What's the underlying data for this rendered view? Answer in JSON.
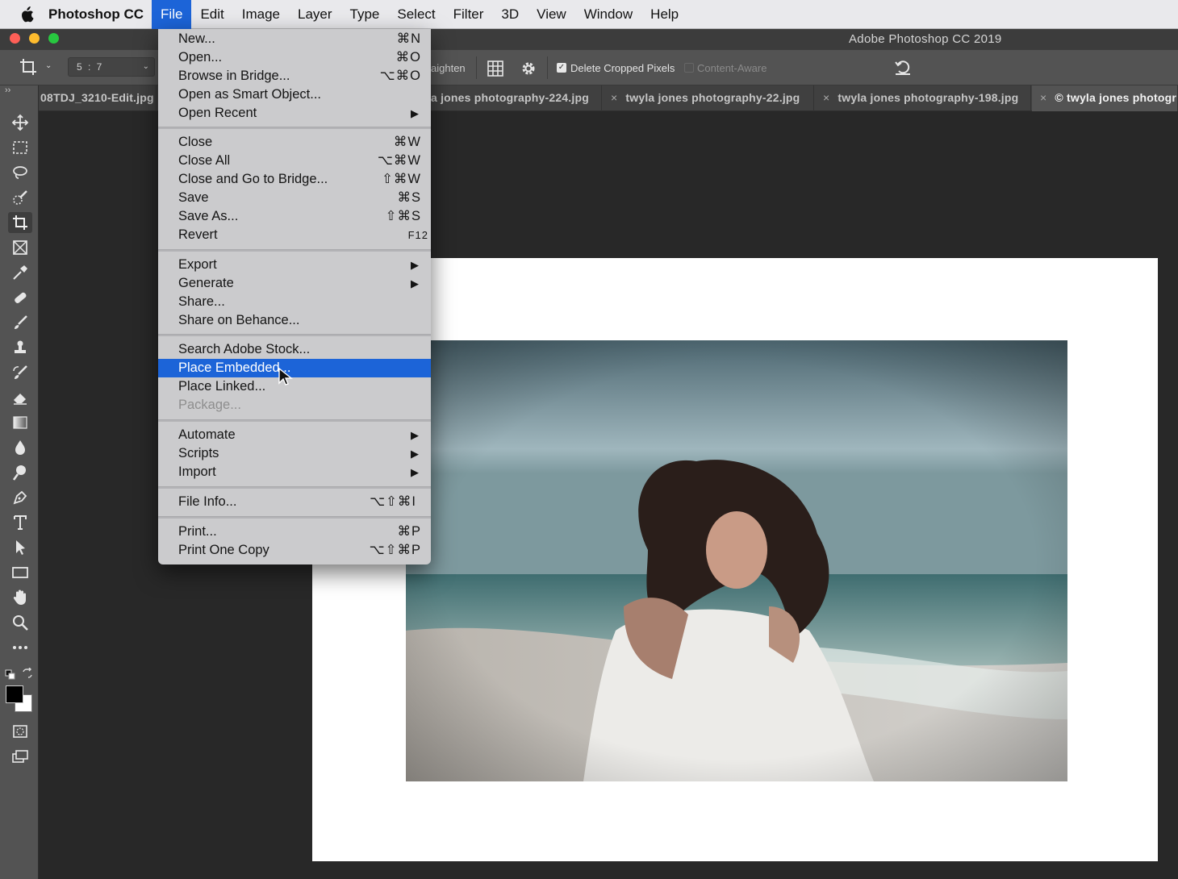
{
  "menubar": {
    "app_name": "Photoshop CC",
    "items": [
      "File",
      "Edit",
      "Image",
      "Layer",
      "Type",
      "Select",
      "Filter",
      "3D",
      "View",
      "Window",
      "Help"
    ],
    "active": "File"
  },
  "window": {
    "title": "Adobe Photoshop CC 2019"
  },
  "options_bar": {
    "ratio": "5 : 7",
    "straighten_label": "aighten",
    "delete_cropped_label": "Delete Cropped Pixels",
    "delete_cropped_checked": true,
    "content_aware_label": "Content-Aware",
    "content_aware_checked": false
  },
  "tabs": [
    {
      "label": "08TDJ_3210-Edit.jpg",
      "closable": false
    },
    {
      "label": "a jones photography-224.jpg",
      "closable": false
    },
    {
      "label": "twyla jones photography-22.jpg",
      "closable": true
    },
    {
      "label": "twyla jones photography-198.jpg",
      "closable": true
    },
    {
      "label": "© twyla jones photogr",
      "closable": true,
      "active": true
    }
  ],
  "close_glyph": "×",
  "tools": [
    "move-tool",
    "marquee-tool",
    "lasso-tool",
    "quick-selection-tool",
    "crop-tool",
    "frame-tool",
    "eyedropper-tool",
    "healing-brush-tool",
    "brush-tool",
    "clone-stamp-tool",
    "history-brush-tool",
    "eraser-tool",
    "gradient-tool",
    "blur-tool",
    "dodge-tool",
    "pen-tool",
    "type-tool",
    "path-selection-tool",
    "rectangle-tool",
    "hand-tool",
    "zoom-tool",
    "edit-toolbar",
    "quick-mask-mode",
    "screen-mode"
  ],
  "active_tool": "crop-tool",
  "colors": {
    "foreground": "#000000",
    "background": "#ffffff",
    "highlight": "#1c64d8"
  },
  "file_menu": {
    "groups": [
      [
        {
          "label": "New...",
          "shortcut": "⌘N"
        },
        {
          "label": "Open...",
          "shortcut": "⌘O"
        },
        {
          "label": "Browse in Bridge...",
          "shortcut": "⌥⌘O"
        },
        {
          "label": "Open as Smart Object...",
          "shortcut": ""
        },
        {
          "label": "Open Recent",
          "shortcut": "",
          "submenu": true
        }
      ],
      [
        {
          "label": "Close",
          "shortcut": "⌘W"
        },
        {
          "label": "Close All",
          "shortcut": "⌥⌘W"
        },
        {
          "label": "Close and Go to Bridge...",
          "shortcut": "⇧⌘W"
        },
        {
          "label": "Save",
          "shortcut": "⌘S"
        },
        {
          "label": "Save As...",
          "shortcut": "⇧⌘S"
        },
        {
          "label": "Revert",
          "shortcut": "F12"
        }
      ],
      [
        {
          "label": "Export",
          "shortcut": "",
          "submenu": true
        },
        {
          "label": "Generate",
          "shortcut": "",
          "submenu": true
        },
        {
          "label": "Share...",
          "shortcut": ""
        },
        {
          "label": "Share on Behance...",
          "shortcut": ""
        }
      ],
      [
        {
          "label": "Search Adobe Stock...",
          "shortcut": ""
        },
        {
          "label": "Place Embedded...",
          "shortcut": "",
          "highlighted": true
        },
        {
          "label": "Place Linked...",
          "shortcut": ""
        },
        {
          "label": "Package...",
          "shortcut": "",
          "disabled": true
        }
      ],
      [
        {
          "label": "Automate",
          "shortcut": "",
          "submenu": true
        },
        {
          "label": "Scripts",
          "shortcut": "",
          "submenu": true
        },
        {
          "label": "Import",
          "shortcut": "",
          "submenu": true
        }
      ],
      [
        {
          "label": "File Info...",
          "shortcut": "⌥⇧⌘I"
        }
      ],
      [
        {
          "label": "Print...",
          "shortcut": "⌘P"
        },
        {
          "label": "Print One Copy",
          "shortcut": "⌥⇧⌘P"
        }
      ]
    ]
  }
}
